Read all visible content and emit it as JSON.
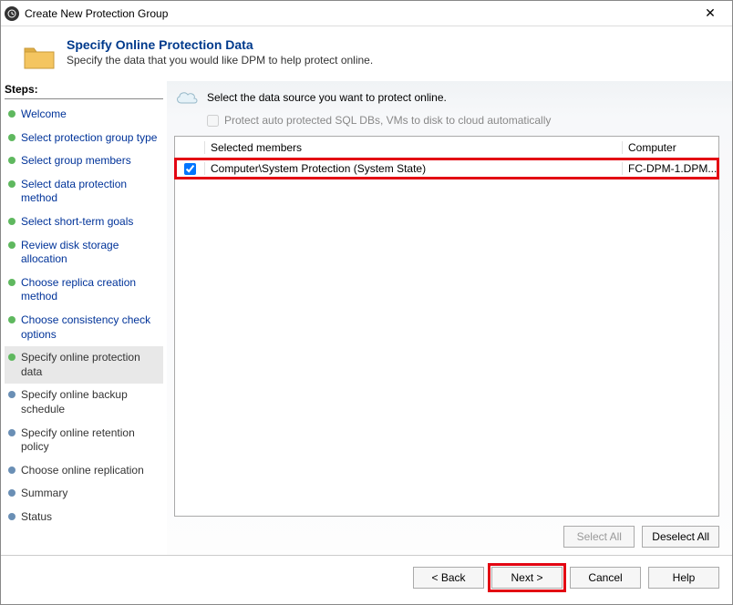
{
  "window": {
    "title": "Create New Protection Group"
  },
  "header": {
    "heading": "Specify Online Protection Data",
    "subheading": "Specify the data that you would like DPM to help protect online."
  },
  "steps": {
    "label": "Steps:",
    "items": [
      {
        "label": "Welcome",
        "state": "completed"
      },
      {
        "label": "Select protection group type",
        "state": "completed"
      },
      {
        "label": "Select group members",
        "state": "completed"
      },
      {
        "label": "Select data protection method",
        "state": "completed"
      },
      {
        "label": "Select short-term goals",
        "state": "completed"
      },
      {
        "label": "Review disk storage allocation",
        "state": "completed"
      },
      {
        "label": "Choose replica creation method",
        "state": "completed"
      },
      {
        "label": "Choose consistency check options",
        "state": "completed"
      },
      {
        "label": "Specify online protection data",
        "state": "current"
      },
      {
        "label": "Specify online backup schedule",
        "state": "pending"
      },
      {
        "label": "Specify online retention policy",
        "state": "pending"
      },
      {
        "label": "Choose online replication",
        "state": "pending"
      },
      {
        "label": "Summary",
        "state": "pending"
      },
      {
        "label": "Status",
        "state": "pending"
      }
    ]
  },
  "main": {
    "instruction": "Select the data source you want to protect online.",
    "auto_protect_label": "Protect auto protected SQL DBs, VMs to disk to cloud automatically",
    "columns": {
      "members": "Selected members",
      "computer": "Computer"
    },
    "rows": [
      {
        "checked": true,
        "member": "Computer\\System Protection (System State)",
        "computer": "FC-DPM-1.DPM..."
      }
    ],
    "select_all": "Select All",
    "deselect_all": "Deselect All"
  },
  "footer": {
    "back": "< Back",
    "next": "Next >",
    "cancel": "Cancel",
    "help": "Help"
  }
}
